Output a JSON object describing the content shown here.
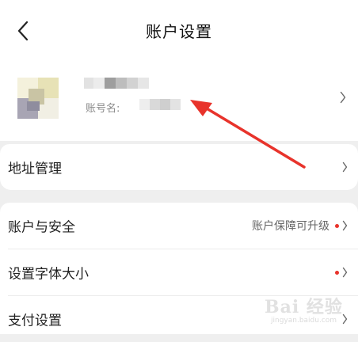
{
  "header": {
    "title": "账户设置",
    "back_icon": "chevron-left-icon"
  },
  "profile": {
    "account_label": "账号名:",
    "chevron_icon": "chevron-right-icon"
  },
  "address": {
    "label": "地址管理",
    "chevron_icon": "chevron-right-icon"
  },
  "settings": [
    {
      "label": "账户与安全",
      "status": "账户保障可升级",
      "has_dot": true
    },
    {
      "label": "设置字体大小",
      "status": "",
      "has_dot": true
    },
    {
      "label": "支付设置",
      "status": "",
      "has_dot": false
    }
  ],
  "annotation": {
    "arrow_color": "#e8332b",
    "points_to": "account-name"
  },
  "watermark": {
    "logo": "Bai 经验",
    "sub": "jingyan.baidu.com"
  },
  "colors": {
    "accent": "#e8332b",
    "background": "#efefef",
    "card": "#ffffff"
  }
}
